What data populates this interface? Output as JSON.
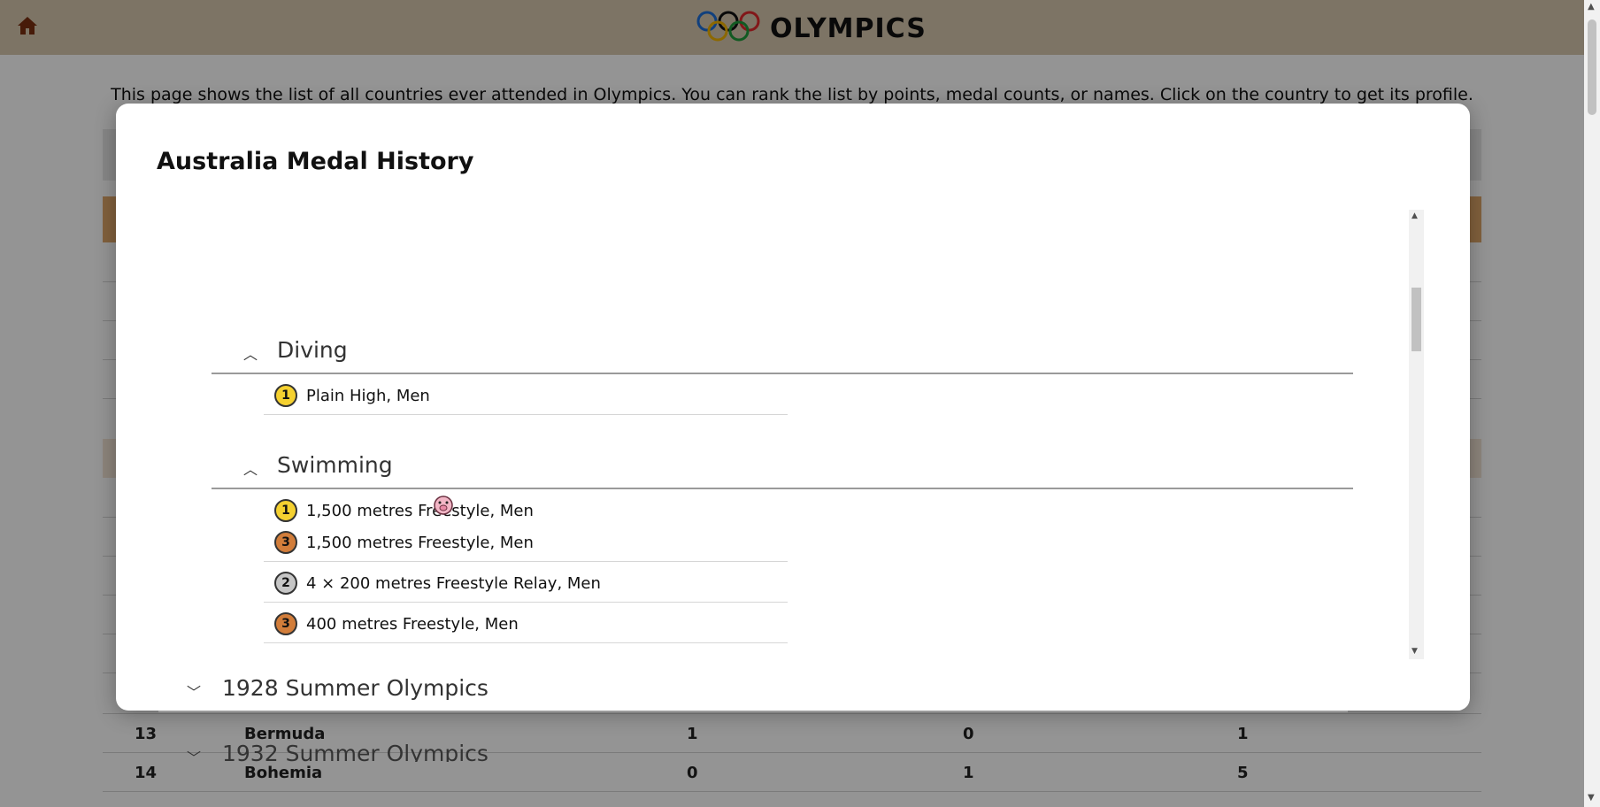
{
  "header": {
    "title": "OLYMPICS",
    "home_icon": "home-icon",
    "logo_icon": "olympic-rings-icon"
  },
  "intro_text": "This page shows the list of all countries ever attended in Olympics. You can rank the list by points, medal counts, or names. Click on the country to get its profile.",
  "background_rows": [
    {
      "rank": "13",
      "country": "Bermuda",
      "gold": "1",
      "silver": "0",
      "bronze": "1"
    },
    {
      "rank": "14",
      "country": "Bohemia",
      "gold": "0",
      "silver": "1",
      "bronze": "5"
    }
  ],
  "modal": {
    "title": "Australia Medal History",
    "sports": [
      {
        "name": "Diving",
        "expanded": true,
        "events": [
          {
            "medal": "gold",
            "medal_text": "1",
            "label": "Plain High, Men"
          }
        ]
      },
      {
        "name": "Swimming",
        "expanded": true,
        "events": [
          {
            "medal": "gold",
            "medal_text": "1",
            "label": "1,500 metres Freestyle, Men"
          },
          {
            "medal": "bronze",
            "medal_text": "3",
            "label": "1,500 metres Freestyle, Men"
          },
          {
            "medal": "silver",
            "medal_text": "2",
            "label": "4 × 200 metres Freestyle Relay, Men"
          },
          {
            "medal": "bronze",
            "medal_text": "3",
            "label": "400 metres Freestyle, Men"
          }
        ]
      }
    ],
    "games": [
      {
        "name": "1928 Summer Olympics",
        "expanded": false
      },
      {
        "name": "1932 Summer Olympics",
        "expanded": false
      }
    ]
  },
  "colors": {
    "topbar": "#d8c8ae",
    "table_header": "#e0a86a",
    "gold": "#f5d130",
    "silver": "#c6c6c6",
    "bronze": "#d27d3a"
  }
}
